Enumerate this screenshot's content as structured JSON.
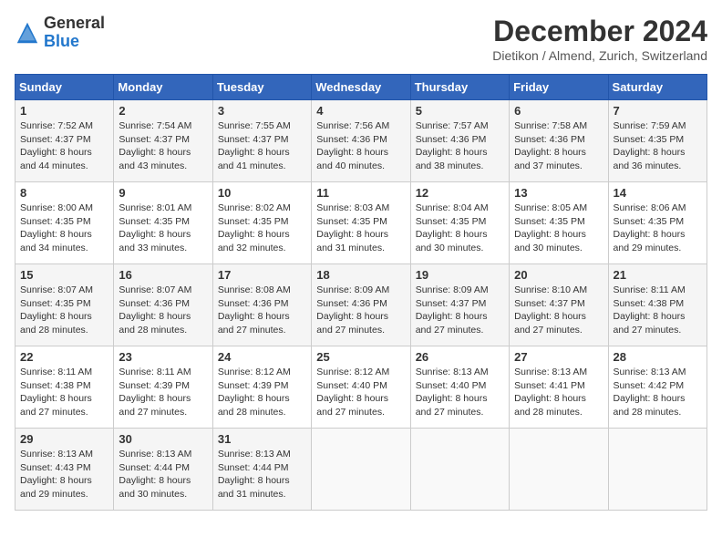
{
  "header": {
    "logo_general": "General",
    "logo_blue": "Blue",
    "month_title": "December 2024",
    "location": "Dietikon / Almend, Zurich, Switzerland"
  },
  "days_of_week": [
    "Sunday",
    "Monday",
    "Tuesday",
    "Wednesday",
    "Thursday",
    "Friday",
    "Saturday"
  ],
  "weeks": [
    [
      {
        "day": "1",
        "sunrise": "7:52 AM",
        "sunset": "4:37 PM",
        "daylight": "8 hours and 44 minutes."
      },
      {
        "day": "2",
        "sunrise": "7:54 AM",
        "sunset": "4:37 PM",
        "daylight": "8 hours and 43 minutes."
      },
      {
        "day": "3",
        "sunrise": "7:55 AM",
        "sunset": "4:37 PM",
        "daylight": "8 hours and 41 minutes."
      },
      {
        "day": "4",
        "sunrise": "7:56 AM",
        "sunset": "4:36 PM",
        "daylight": "8 hours and 40 minutes."
      },
      {
        "day": "5",
        "sunrise": "7:57 AM",
        "sunset": "4:36 PM",
        "daylight": "8 hours and 38 minutes."
      },
      {
        "day": "6",
        "sunrise": "7:58 AM",
        "sunset": "4:36 PM",
        "daylight": "8 hours and 37 minutes."
      },
      {
        "day": "7",
        "sunrise": "7:59 AM",
        "sunset": "4:35 PM",
        "daylight": "8 hours and 36 minutes."
      }
    ],
    [
      {
        "day": "8",
        "sunrise": "8:00 AM",
        "sunset": "4:35 PM",
        "daylight": "8 hours and 34 minutes."
      },
      {
        "day": "9",
        "sunrise": "8:01 AM",
        "sunset": "4:35 PM",
        "daylight": "8 hours and 33 minutes."
      },
      {
        "day": "10",
        "sunrise": "8:02 AM",
        "sunset": "4:35 PM",
        "daylight": "8 hours and 32 minutes."
      },
      {
        "day": "11",
        "sunrise": "8:03 AM",
        "sunset": "4:35 PM",
        "daylight": "8 hours and 31 minutes."
      },
      {
        "day": "12",
        "sunrise": "8:04 AM",
        "sunset": "4:35 PM",
        "daylight": "8 hours and 30 minutes."
      },
      {
        "day": "13",
        "sunrise": "8:05 AM",
        "sunset": "4:35 PM",
        "daylight": "8 hours and 30 minutes."
      },
      {
        "day": "14",
        "sunrise": "8:06 AM",
        "sunset": "4:35 PM",
        "daylight": "8 hours and 29 minutes."
      }
    ],
    [
      {
        "day": "15",
        "sunrise": "8:07 AM",
        "sunset": "4:35 PM",
        "daylight": "8 hours and 28 minutes."
      },
      {
        "day": "16",
        "sunrise": "8:07 AM",
        "sunset": "4:36 PM",
        "daylight": "8 hours and 28 minutes."
      },
      {
        "day": "17",
        "sunrise": "8:08 AM",
        "sunset": "4:36 PM",
        "daylight": "8 hours and 27 minutes."
      },
      {
        "day": "18",
        "sunrise": "8:09 AM",
        "sunset": "4:36 PM",
        "daylight": "8 hours and 27 minutes."
      },
      {
        "day": "19",
        "sunrise": "8:09 AM",
        "sunset": "4:37 PM",
        "daylight": "8 hours and 27 minutes."
      },
      {
        "day": "20",
        "sunrise": "8:10 AM",
        "sunset": "4:37 PM",
        "daylight": "8 hours and 27 minutes."
      },
      {
        "day": "21",
        "sunrise": "8:11 AM",
        "sunset": "4:38 PM",
        "daylight": "8 hours and 27 minutes."
      }
    ],
    [
      {
        "day": "22",
        "sunrise": "8:11 AM",
        "sunset": "4:38 PM",
        "daylight": "8 hours and 27 minutes."
      },
      {
        "day": "23",
        "sunrise": "8:11 AM",
        "sunset": "4:39 PM",
        "daylight": "8 hours and 27 minutes."
      },
      {
        "day": "24",
        "sunrise": "8:12 AM",
        "sunset": "4:39 PM",
        "daylight": "8 hours and 28 minutes."
      },
      {
        "day": "25",
        "sunrise": "8:12 AM",
        "sunset": "4:40 PM",
        "daylight": "8 hours and 27 minutes."
      },
      {
        "day": "26",
        "sunrise": "8:13 AM",
        "sunset": "4:40 PM",
        "daylight": "8 hours and 27 minutes."
      },
      {
        "day": "27",
        "sunrise": "8:13 AM",
        "sunset": "4:41 PM",
        "daylight": "8 hours and 28 minutes."
      },
      {
        "day": "28",
        "sunrise": "8:13 AM",
        "sunset": "4:42 PM",
        "daylight": "8 hours and 28 minutes."
      }
    ],
    [
      {
        "day": "29",
        "sunrise": "8:13 AM",
        "sunset": "4:43 PM",
        "daylight": "8 hours and 29 minutes."
      },
      {
        "day": "30",
        "sunrise": "8:13 AM",
        "sunset": "4:44 PM",
        "daylight": "8 hours and 30 minutes."
      },
      {
        "day": "31",
        "sunrise": "8:13 AM",
        "sunset": "4:44 PM",
        "daylight": "8 hours and 31 minutes."
      },
      null,
      null,
      null,
      null
    ]
  ],
  "labels": {
    "sunrise": "Sunrise:",
    "sunset": "Sunset:",
    "daylight": "Daylight:"
  }
}
